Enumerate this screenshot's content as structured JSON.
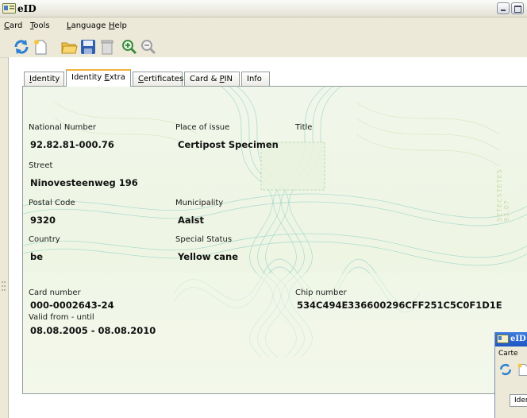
{
  "window": {
    "title": "eID"
  },
  "menu": [
    {
      "label": "Card",
      "accel": "C",
      "rest": "ard"
    },
    {
      "label": "Tools",
      "accel": "T",
      "rest": "ools"
    },
    {
      "label": "Language",
      "accel": "L",
      "rest": "anguage"
    },
    {
      "label": "Help",
      "accel": "H",
      "rest": "elp"
    }
  ],
  "toolbar": {
    "icons": [
      "refresh-icon",
      "new-document-icon",
      "open-folder-icon",
      "save-icon",
      "delete-icon",
      "zoom-in-icon",
      "zoom-out-icon"
    ]
  },
  "tabs": [
    {
      "pre": "",
      "accel": "I",
      "post": "dentity",
      "active": false
    },
    {
      "pre": "Identity ",
      "accel": "E",
      "post": "xtra",
      "active": true
    },
    {
      "pre": "",
      "accel": "C",
      "post": "ertificates",
      "active": false
    },
    {
      "pre": "Card & ",
      "accel": "P",
      "post": "IN",
      "active": false
    },
    {
      "pre": "Info",
      "accel": "",
      "post": "",
      "active": false
    }
  ],
  "fields": {
    "national_number": {
      "label": "National Number",
      "value": "92.82.81-000.76"
    },
    "place_of_issue": {
      "label": "Place of issue",
      "value": "Certipost Specimen"
    },
    "title": {
      "label": "Title",
      "value": ""
    },
    "street": {
      "label": "Street",
      "value": "Ninovesteenweg 196"
    },
    "postal_code": {
      "label": "Postal Code",
      "value": "9320"
    },
    "municipality": {
      "label": "Municipality",
      "value": "Aalst"
    },
    "country": {
      "label": "Country",
      "value": "be"
    },
    "special_status": {
      "label": "Special Status",
      "value": "Yellow cane"
    },
    "card_number": {
      "label": "Card number",
      "value": "000-0002643-24"
    },
    "chip_number": {
      "label": "Chip number",
      "value": "534C494E336600296CFF251C5C0F1D1E"
    },
    "validity": {
      "label": "Valid from - until",
      "value": "08.08.2005 - 08.08.2010"
    }
  },
  "background_side_text": "SETECSTETES 93.07",
  "mini_window": {
    "title": "eID",
    "menu": "Carte",
    "tab": "Ider"
  },
  "colors": {
    "tab_highlight": "#f2b33d",
    "panel_bg": "#eef5e3",
    "guilloche": "#8fd0c4",
    "titlebar_blue": "#1f56c4"
  }
}
